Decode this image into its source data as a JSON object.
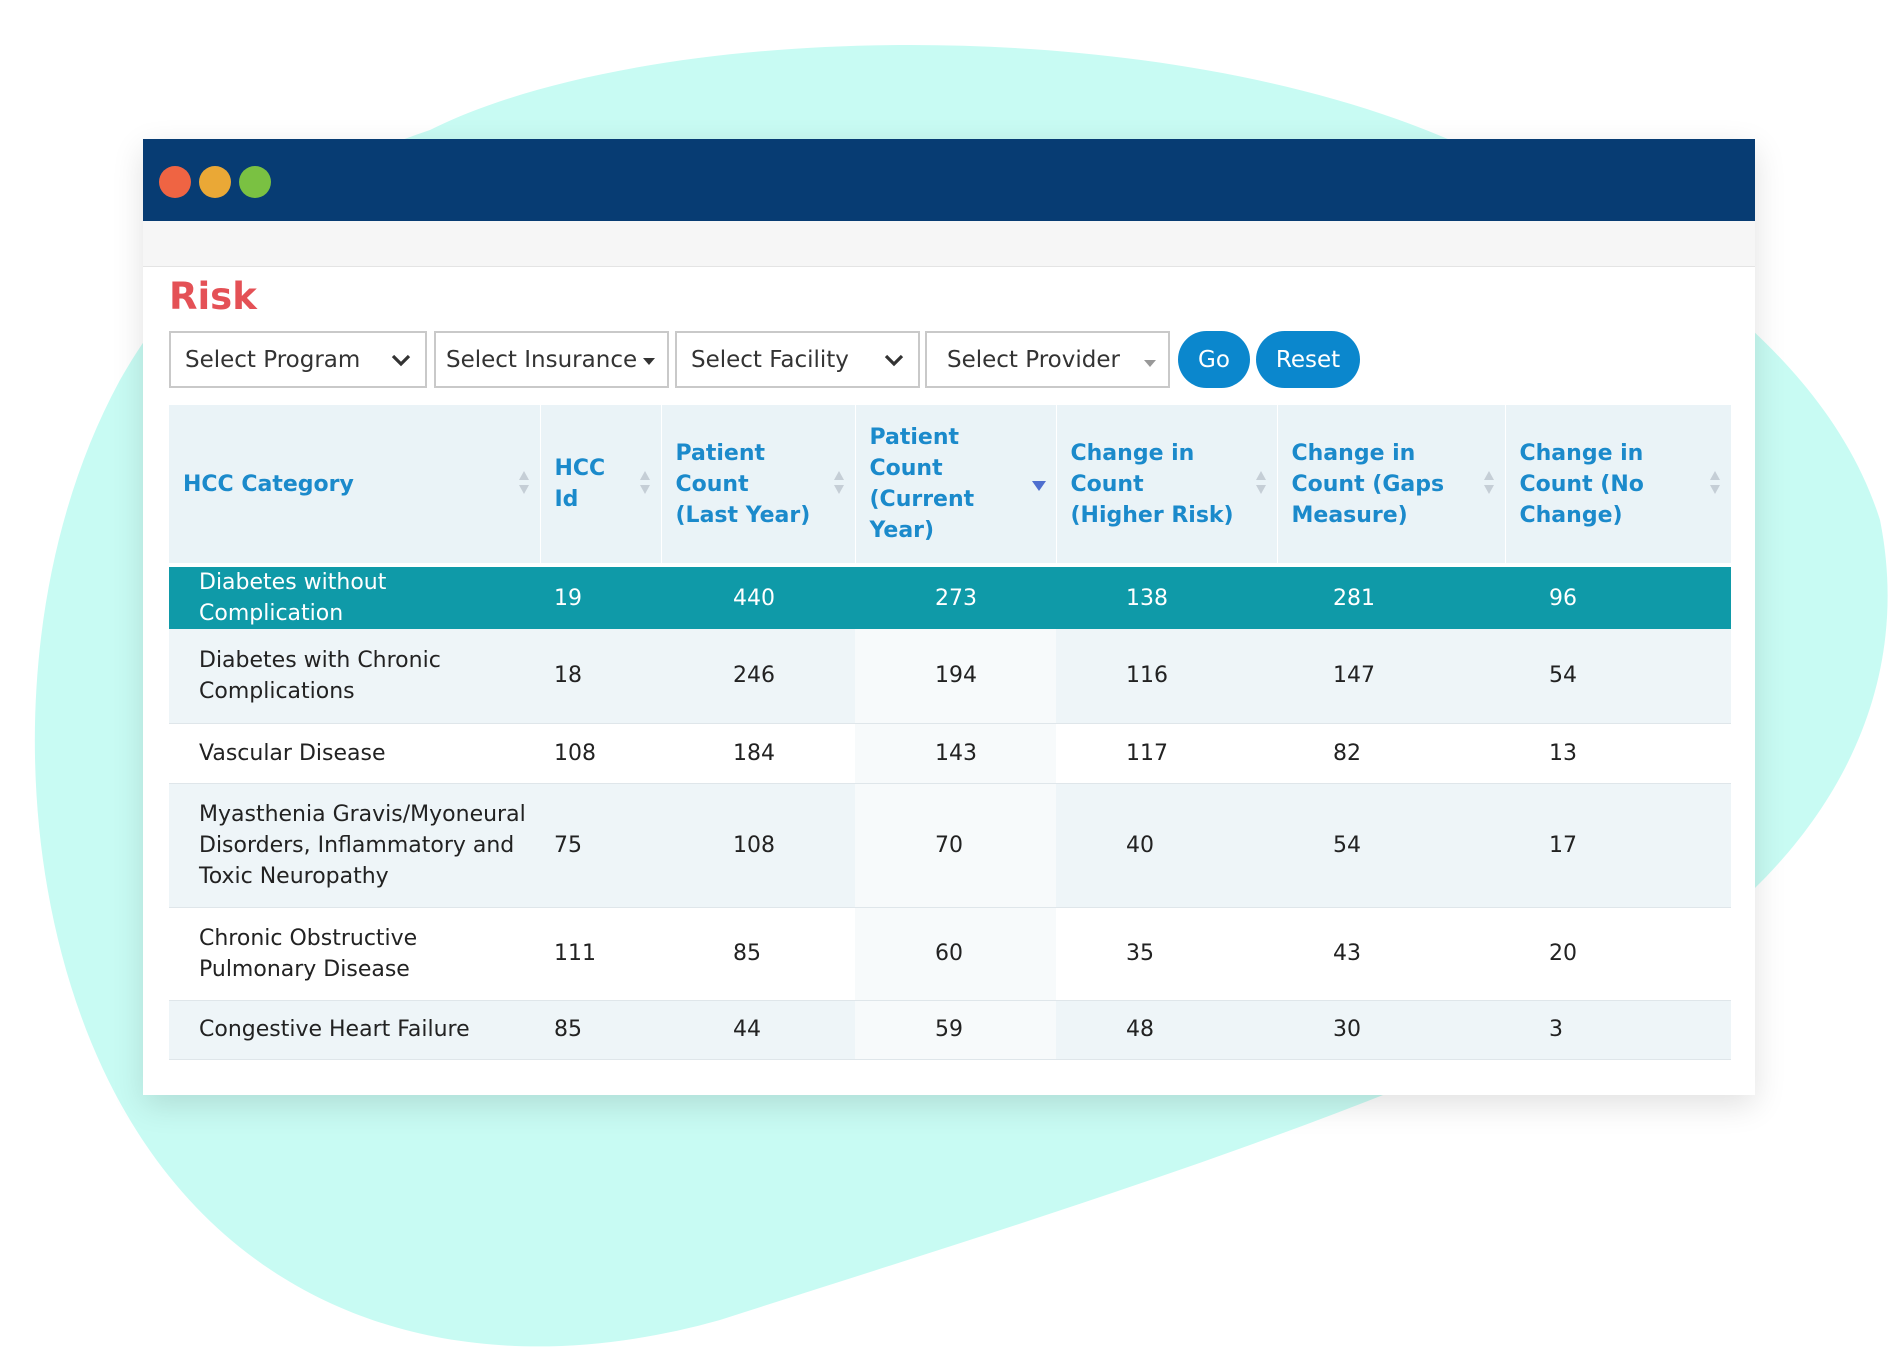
{
  "page": {
    "title": "Risk"
  },
  "filters": {
    "program": "Select Program",
    "insurance": "Select Insurance",
    "facility": "Select Facility",
    "provider": "Select Provider"
  },
  "buttons": {
    "go": "Go",
    "reset": "Reset"
  },
  "table": {
    "headers": [
      "HCC Category",
      "HCC Id",
      "Patient Count (Last Year)",
      "Patient Count (Current Year)",
      "Change in Count (Higher Risk)",
      "Change in Count (Gaps Measure)",
      "Change in Count (No Change)"
    ],
    "rows": [
      [
        "Diabetes without Complication",
        "19",
        "440",
        "273",
        "138",
        "281",
        "96"
      ],
      [
        "Diabetes with Chronic Complications",
        "18",
        "246",
        "194",
        "116",
        "147",
        "54"
      ],
      [
        "Vascular Disease",
        "108",
        "184",
        "143",
        "117",
        "82",
        "13"
      ],
      [
        "Myasthenia Gravis/Myoneural Disorders, Inflammatory and Toxic Neuropathy",
        "75",
        "108",
        "70",
        "40",
        "54",
        "17"
      ],
      [
        "Chronic Obstructive Pulmonary Disease",
        "111",
        "85",
        "60",
        "35",
        "43",
        "20"
      ],
      [
        "Congestive Heart Failure",
        "85",
        "44",
        "59",
        "48",
        "30",
        "3"
      ]
    ]
  },
  "icons": {
    "window_controls": [
      "close-dot",
      "minimize-dot",
      "maximize-dot"
    ],
    "sort": "sort-arrows-icon",
    "sorted_desc": "sort-desc-icon",
    "dropdown": "chevron-down-icon"
  },
  "colors": {
    "titlebar": "#073c73",
    "title": "#e45156",
    "header_text": "#1b8acb",
    "highlight_row": "#0f9aa8",
    "button": "#0b87cd",
    "blob": "#c8fbf3"
  }
}
